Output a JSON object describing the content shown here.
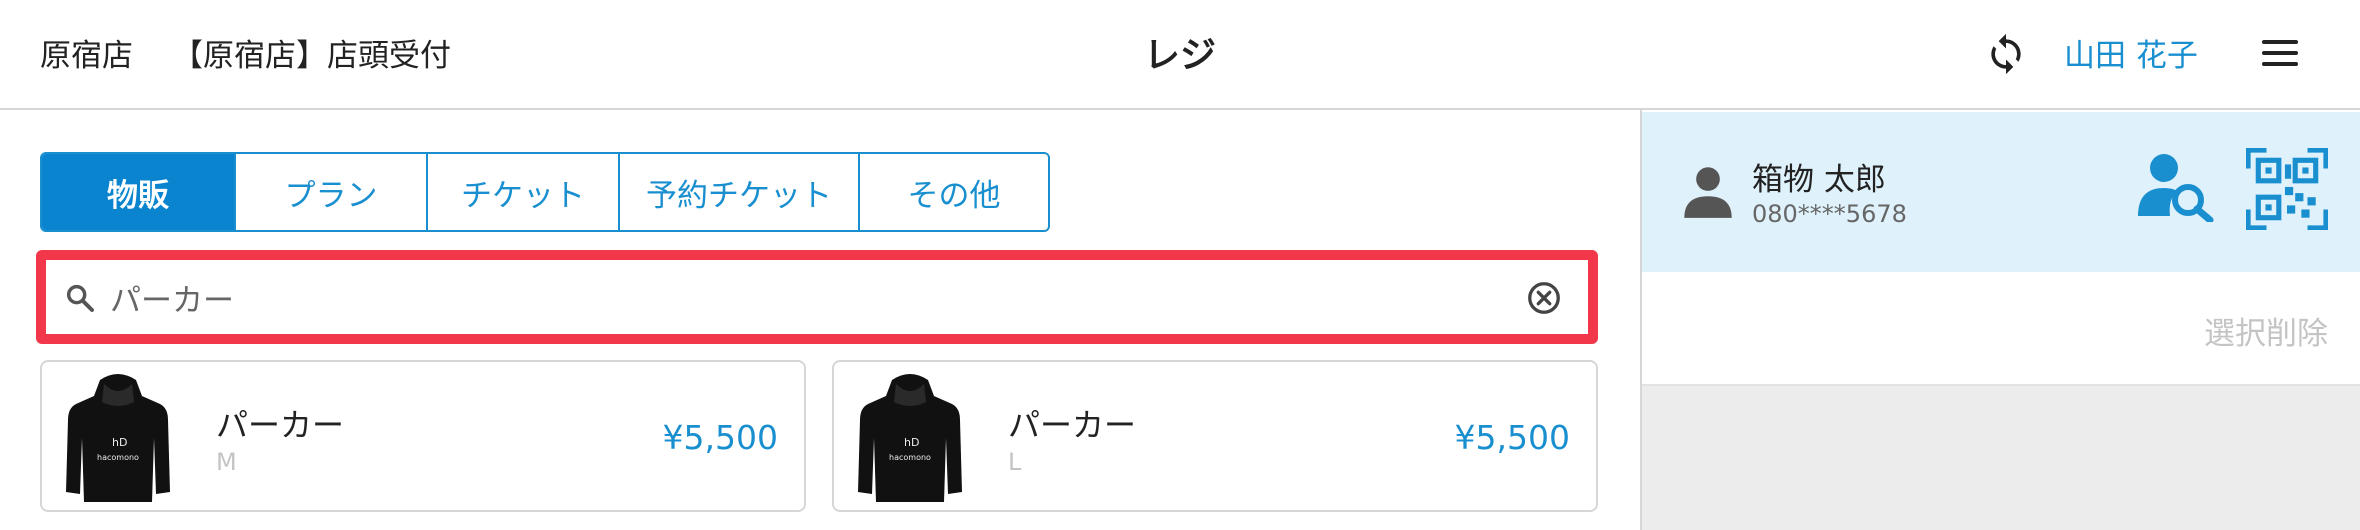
{
  "header": {
    "store": "原宿店",
    "counter": "【原宿店】店頭受付",
    "title": "レジ",
    "user": "山田 花子"
  },
  "tabs": [
    {
      "label": "物販",
      "active": true
    },
    {
      "label": "プラン",
      "active": false
    },
    {
      "label": "チケット",
      "active": false
    },
    {
      "label": "予約チケット",
      "active": false
    },
    {
      "label": "その他",
      "active": false
    }
  ],
  "search": {
    "value": "パーカー",
    "icon": "search-icon",
    "clear_icon": "clear-circle-icon"
  },
  "products": [
    {
      "name": "パーカー",
      "variant": "M",
      "price": "¥5,500",
      "brand": "hacomono"
    },
    {
      "name": "パーカー",
      "variant": "L",
      "price": "¥5,500",
      "brand": "hacomono"
    }
  ],
  "customer": {
    "name": "箱物 太郎",
    "phone": "080****5678"
  },
  "cart": {
    "clear_selection_label": "選択削除"
  },
  "colors": {
    "accent": "#1a8fd0",
    "tab_active_bg": "#0a84cf",
    "highlight_border": "#f2374a",
    "customer_bg": "#dff1fb"
  }
}
